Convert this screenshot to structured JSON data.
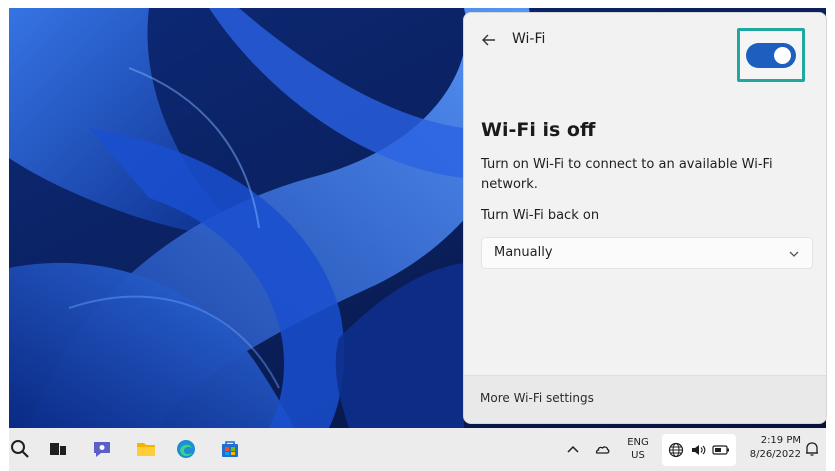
{
  "wifi_panel": {
    "title": "Wi-Fi",
    "toggle_state": "on",
    "status_heading": "Wi-Fi is off",
    "description": "Turn on Wi-Fi to connect to an available Wi-Fi network.",
    "turn_back_on_label": "Turn Wi-Fi back on",
    "turn_back_on_value": "Manually",
    "footer_link": "More Wi-Fi settings"
  },
  "taskbar": {
    "apps": [
      {
        "icon": "search-icon"
      },
      {
        "icon": "task-view-icon"
      },
      {
        "icon": "chat-icon"
      },
      {
        "icon": "file-explorer-icon"
      },
      {
        "icon": "edge-icon"
      },
      {
        "icon": "store-icon"
      }
    ],
    "tray": {
      "language_line1": "ENG",
      "language_line2": "US",
      "time": "2:19 PM",
      "date": "8/26/2022"
    }
  },
  "colors": {
    "accent": "#1c5fbf",
    "highlight_frame": "#1fa8a0",
    "panel_bg": "#f2f2f2",
    "taskbar_bg": "#ececec"
  }
}
